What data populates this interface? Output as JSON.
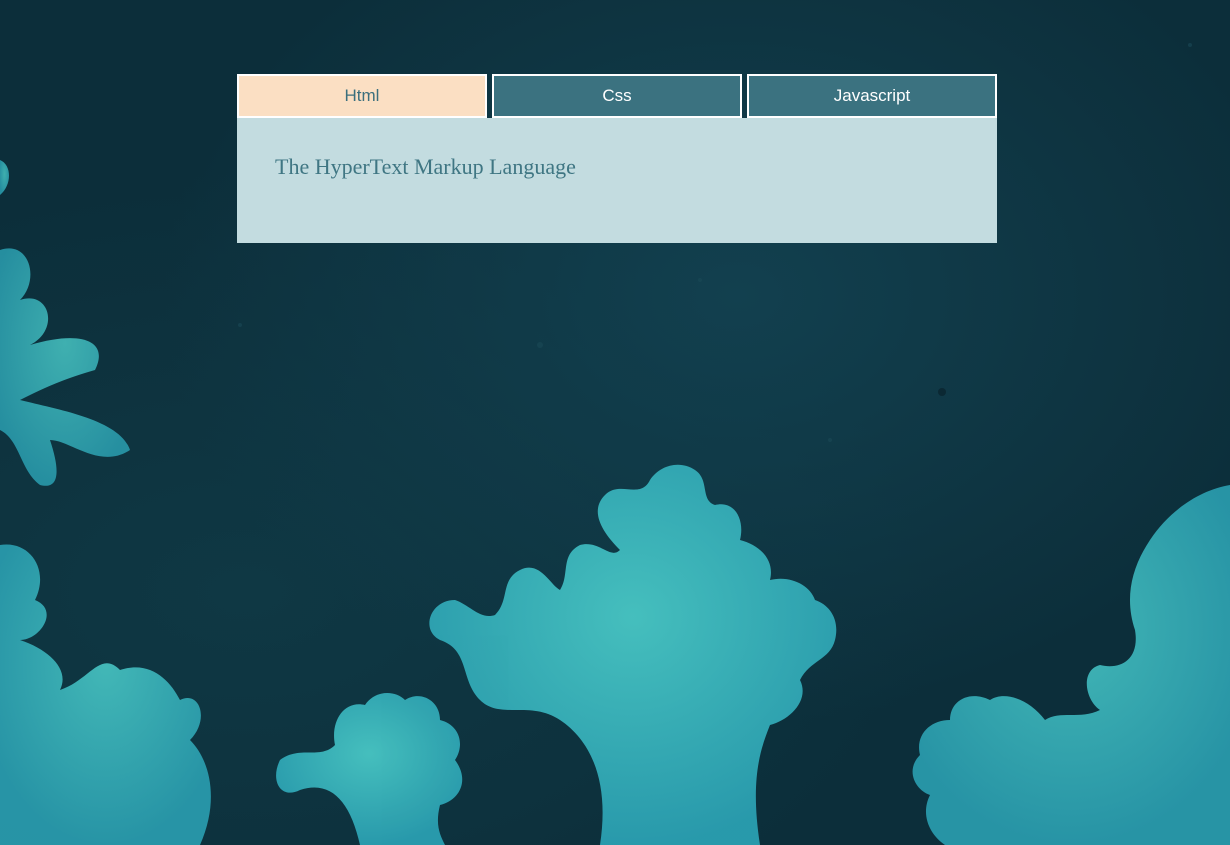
{
  "tabs": [
    {
      "label": "Html",
      "active": true
    },
    {
      "label": "Css",
      "active": false
    },
    {
      "label": "Javascript",
      "active": false
    }
  ],
  "panel": {
    "text": "The HyperText Markup Language"
  },
  "colors": {
    "background": "#0c2e3a",
    "tab_inactive": "#3b7280",
    "tab_active": "#fbdfc3",
    "panel": "#c3dce0",
    "panel_text": "#3f7683",
    "coral": "#2fb5b3"
  }
}
